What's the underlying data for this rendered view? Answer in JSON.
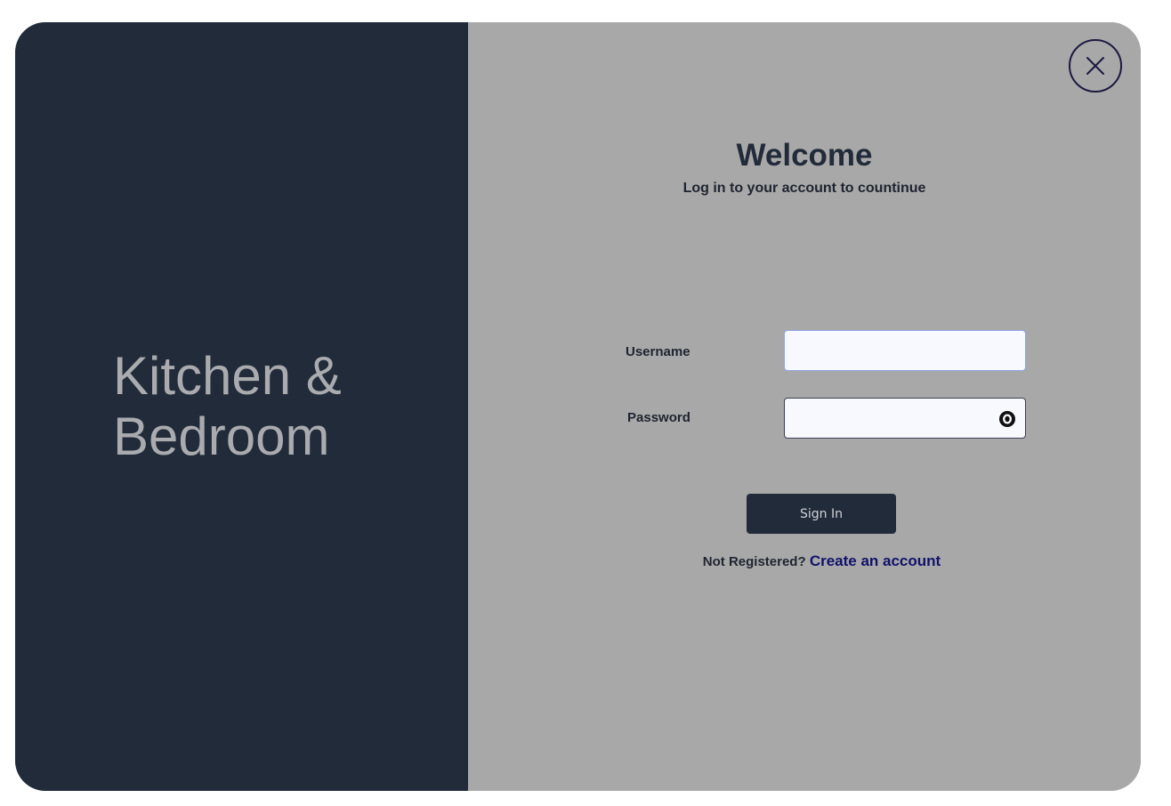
{
  "brand": {
    "line1": "Kitchen &",
    "line2": "Bedroom"
  },
  "login": {
    "title": "Welcome",
    "subtitle": "Log in to your account to countinue",
    "username_label": "Username",
    "username_value": "",
    "password_label": "Password",
    "password_value": "",
    "signin_label": "Sign In",
    "register_prompt": "Not Registered?",
    "register_link": "Create an account"
  },
  "icons": {
    "close": "close-icon",
    "show_password": "eye-icon"
  },
  "colors": {
    "left_panel": "#222b39",
    "right_panel": "#a8a8a8",
    "brand_text": "#a9abae",
    "link": "#10126a",
    "button": "#222b39"
  }
}
